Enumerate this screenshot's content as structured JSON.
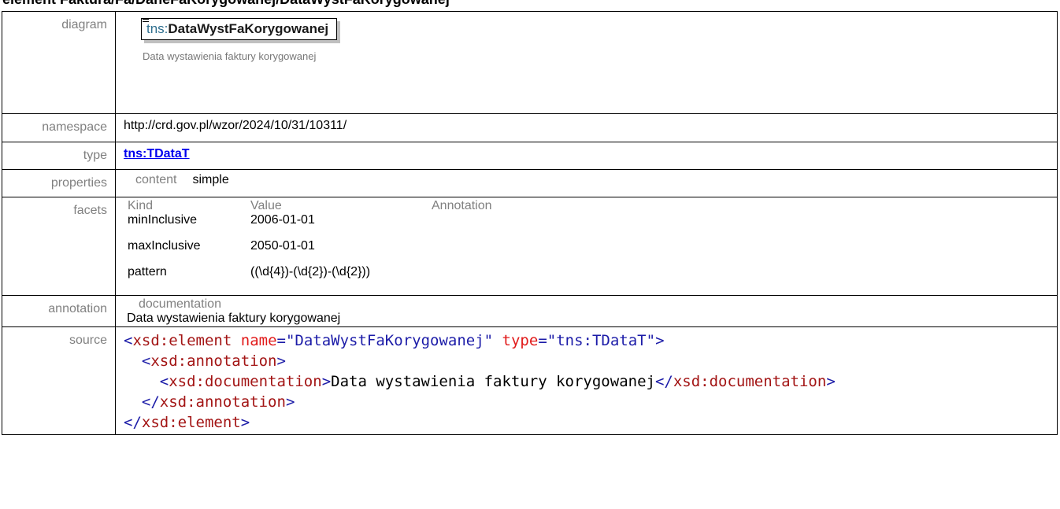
{
  "title": "element Faktura/Fa/DaneFaKorygowanej/DataWystFaKorygowanej",
  "rows": {
    "diagram": {
      "label": "diagram",
      "element_prefix": "tns:",
      "element_name": "DataWystFaKorygowanej",
      "doc_text": "Data wystawienia faktury korygowanej"
    },
    "namespace": {
      "label": "namespace",
      "value": "http://crd.gov.pl/wzor/2024/10/31/10311/"
    },
    "type": {
      "label": "type",
      "value": "tns:TDataT"
    },
    "properties": {
      "label": "properties",
      "key": "content",
      "value": "simple"
    },
    "facets": {
      "label": "facets",
      "headers": [
        "Kind",
        "Value",
        "Annotation"
      ],
      "items": [
        {
          "kind": "minInclusive",
          "value": "2006-01-01",
          "annotation": ""
        },
        {
          "kind": "maxInclusive",
          "value": "2050-01-01",
          "annotation": ""
        },
        {
          "kind": "pattern",
          "value": "((\\d{4})-(\\d{2})-(\\d{2}))",
          "annotation": ""
        }
      ]
    },
    "annotation": {
      "label": "annotation",
      "key": "documentation",
      "value": "Data wystawienia faktury korygowanej"
    },
    "source": {
      "label": "source",
      "lines": [
        "<xsd:element name=\"DataWystFaKorygowanej\" type=\"tns:TDataT\">",
        "  <xsd:annotation>",
        "    <xsd:documentation>Data wystawienia faktury korygowanej</xsd:documentation>",
        "  </xsd:annotation>",
        "</xsd:element>"
      ]
    }
  }
}
